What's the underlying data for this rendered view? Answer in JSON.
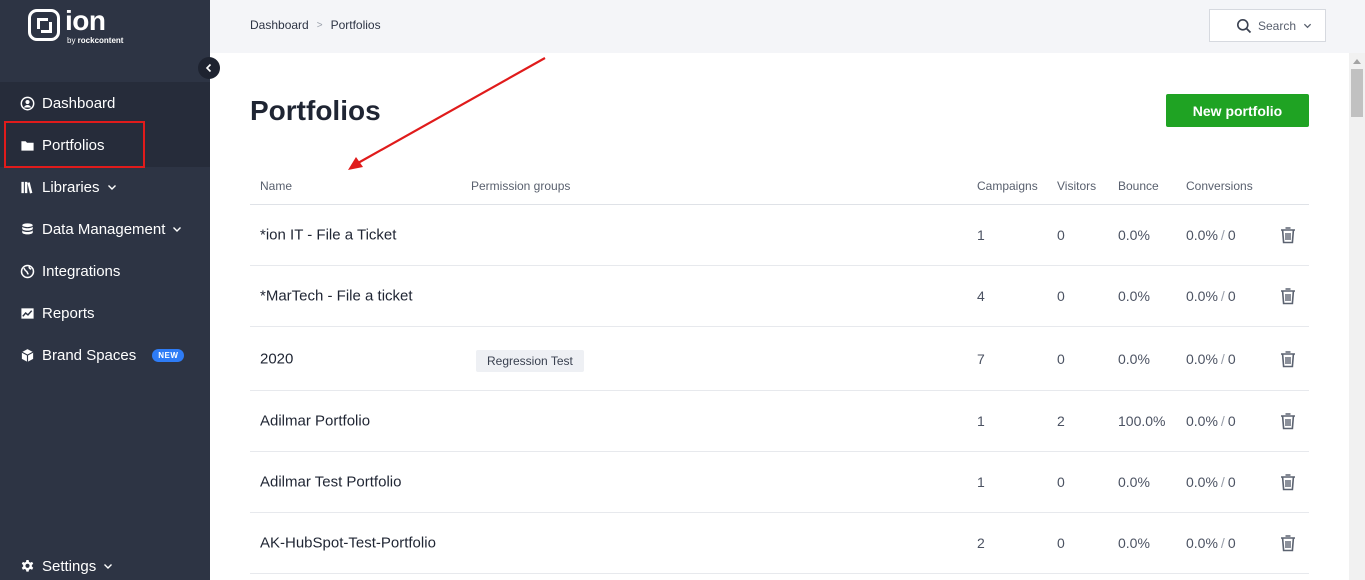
{
  "brand": {
    "word": "ion",
    "sub_prefix": "by ",
    "sub_bold": "rockcontent"
  },
  "sidebar": {
    "items": [
      {
        "label": "Dashboard",
        "icon": "user-circle-icon"
      },
      {
        "label": "Portfolios",
        "icon": "folder-icon"
      },
      {
        "label": "Libraries",
        "icon": "books-icon",
        "has_dropdown": true
      },
      {
        "label": "Data Management",
        "icon": "database-icon",
        "has_dropdown": true
      },
      {
        "label": "Integrations",
        "icon": "globe-icon"
      },
      {
        "label": "Reports",
        "icon": "chart-line-icon"
      },
      {
        "label": "Brand Spaces",
        "icon": "cube-icon",
        "badge": "NEW"
      }
    ],
    "settings_label": "Settings"
  },
  "breadcrumb": {
    "items": [
      "Dashboard",
      "Portfolios"
    ],
    "separator": ">"
  },
  "search": {
    "label": "Search"
  },
  "page": {
    "title": "Portfolios",
    "new_button": "New portfolio"
  },
  "table": {
    "columns": {
      "name": "Name",
      "permission_groups": "Permission groups",
      "campaigns": "Campaigns",
      "visitors": "Visitors",
      "bounce": "Bounce",
      "conversions": "Conversions"
    },
    "rows": [
      {
        "name": "*ion IT - File a Ticket",
        "group": "",
        "campaigns": "1",
        "visitors": "0",
        "bounce": "0.0%",
        "conv_rate": "0.0%",
        "conv_count": "0"
      },
      {
        "name": "*MarTech - File a ticket",
        "group": "",
        "campaigns": "4",
        "visitors": "0",
        "bounce": "0.0%",
        "conv_rate": "0.0%",
        "conv_count": "0"
      },
      {
        "name": "2020",
        "group": "Regression Test",
        "campaigns": "7",
        "visitors": "0",
        "bounce": "0.0%",
        "conv_rate": "0.0%",
        "conv_count": "0"
      },
      {
        "name": "Adilmar Portfolio",
        "group": "",
        "campaigns": "1",
        "visitors": "2",
        "bounce": "100.0%",
        "conv_rate": "0.0%",
        "conv_count": "0"
      },
      {
        "name": "Adilmar Test Portfolio",
        "group": "",
        "campaigns": "1",
        "visitors": "0",
        "bounce": "0.0%",
        "conv_rate": "0.0%",
        "conv_count": "0"
      },
      {
        "name": "AK-HubSpot-Test-Portfolio",
        "group": "",
        "campaigns": "2",
        "visitors": "0",
        "bounce": "0.0%",
        "conv_rate": "0.0%",
        "conv_count": "0"
      }
    ],
    "conv_separator": "/"
  },
  "colors": {
    "sidebar_bg": "#2d3444",
    "active_band": "#262c3a",
    "accent_green": "#1fa323",
    "badge_blue": "#2e7cf6",
    "annotation_red": "#e01b1b"
  }
}
